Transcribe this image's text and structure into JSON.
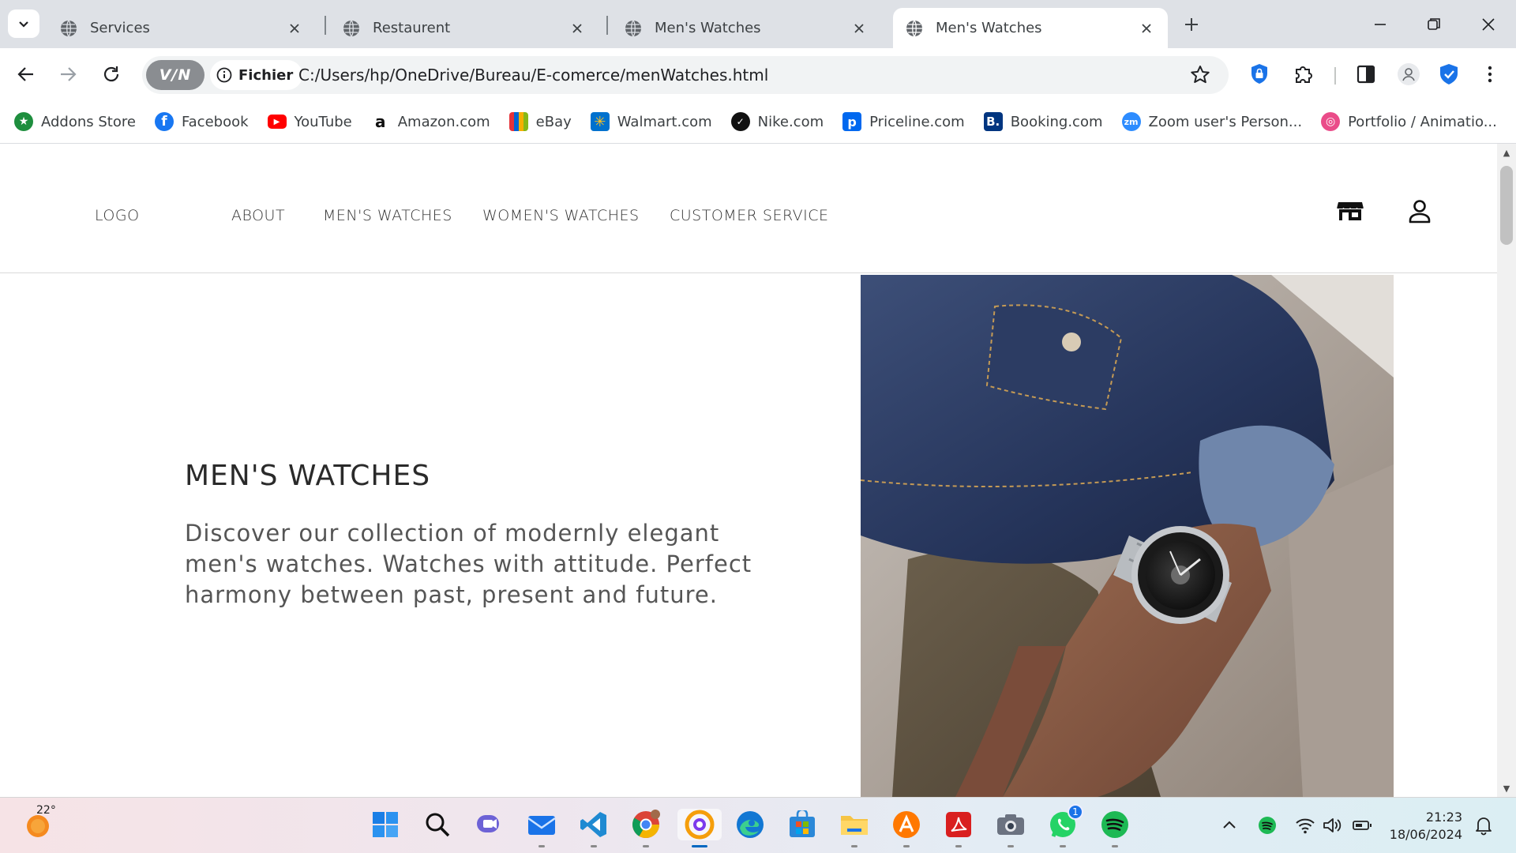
{
  "browser": {
    "tabs": [
      {
        "title": "Services",
        "active": false
      },
      {
        "title": "Restaurent",
        "active": false
      },
      {
        "title": "Men's Watches",
        "active": false
      },
      {
        "title": "Men's Watches",
        "active": true
      }
    ],
    "vpn_label": "V/N",
    "scheme_label": "Fichier",
    "url": "C:/Users/hp/OneDrive/Bureau/E-comerce/menWatches.html"
  },
  "bookmarks": [
    {
      "label": "Addons Store",
      "icon": "addons-store-icon",
      "color": "#1e8e3e"
    },
    {
      "label": "Facebook",
      "icon": "facebook-icon",
      "color": "#1877f2"
    },
    {
      "label": "YouTube",
      "icon": "youtube-icon",
      "color": "#ff0000"
    },
    {
      "label": "Amazon.com",
      "icon": "amazon-icon",
      "color": "#ffffff"
    },
    {
      "label": "eBay",
      "icon": "ebay-icon",
      "color": "#ffffff"
    },
    {
      "label": "Walmart.com",
      "icon": "walmart-icon",
      "color": "#0071ce"
    },
    {
      "label": "Nike.com",
      "icon": "nike-icon",
      "color": "#111111"
    },
    {
      "label": "Priceline.com",
      "icon": "priceline-icon",
      "color": "#0068ef"
    },
    {
      "label": "Booking.com",
      "icon": "booking-icon",
      "color": "#003580"
    },
    {
      "label": "Zoom user's Person...",
      "icon": "zoom-icon",
      "color": "#2d8cff"
    },
    {
      "label": "Portfolio / Animatio...",
      "icon": "dribbble-icon",
      "color": "#ea4c89"
    }
  ],
  "site": {
    "logo": "LOGO",
    "nav": [
      "ABOUT",
      "MEN'S WATCHES",
      "WOMEN'S WATCHES",
      "CUSTOMER SERVICE"
    ],
    "hero": {
      "title": "MEN'S WATCHES",
      "text": "Discover our collection of modernly elegant men's watches. Watches with attitude. Perfect harmony between past, present and future."
    }
  },
  "taskbar": {
    "weather_temp": "22°",
    "whatsapp_badge": "1",
    "time": "21:23",
    "date": "18/06/2024"
  }
}
